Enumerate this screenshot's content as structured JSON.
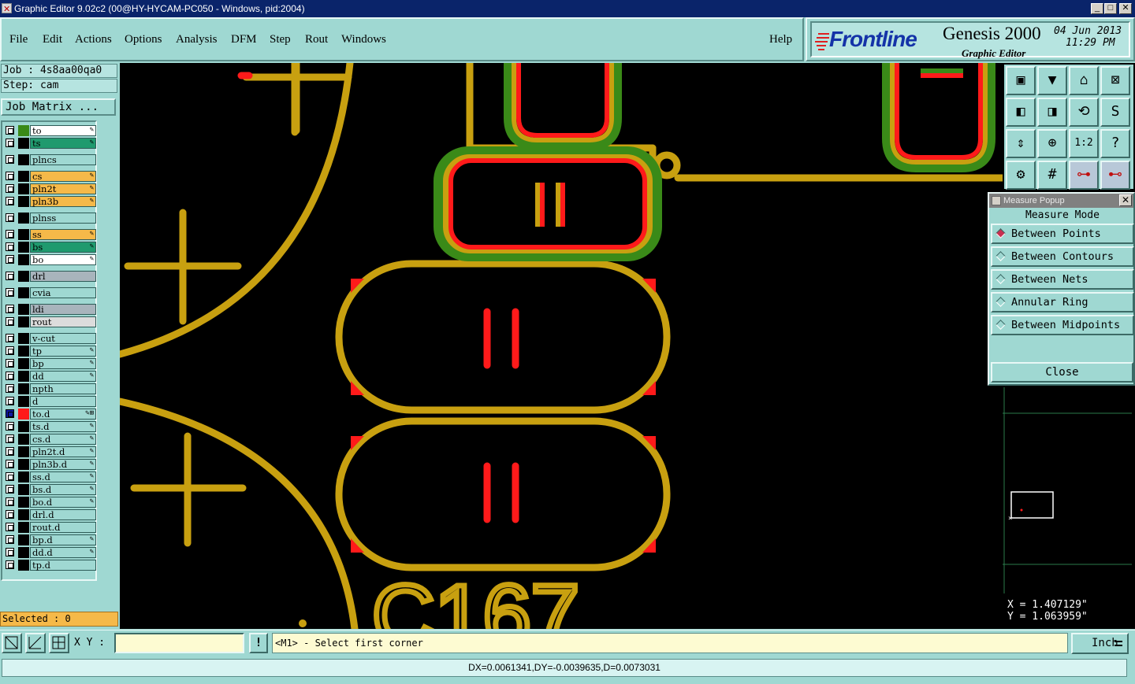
{
  "window": {
    "title": "Graphic Editor 9.02c2 (00@HY-HYCAM-PC050 - Windows, pid:2004)",
    "minimize": "_",
    "maximize": "□",
    "close": "✕"
  },
  "menu": {
    "items": [
      "File",
      "Edit",
      "Actions",
      "Options",
      "Analysis",
      "DFM",
      "Step",
      "Rout",
      "Windows"
    ],
    "help": "Help"
  },
  "branding": {
    "logo": "Frontline",
    "product": "Genesis 2000",
    "subtitle": "Graphic Editor",
    "date": "04 Jun 2013",
    "time": "11:29 PM"
  },
  "job": {
    "job_label": "Job : 4s8aa00qa0",
    "step_label": "Step: cam",
    "matrix_button": "Job Matrix ..."
  },
  "layers": [
    {
      "name": "to",
      "color": "#ffffff",
      "swatch": "#3a8a18",
      "flag": "✎"
    },
    {
      "name": "ts",
      "color": "#1f9a6e",
      "swatch": "#000000",
      "flag": "✎"
    },
    {
      "name": "plncs",
      "color": "#9fd8d2",
      "swatch": "#000000",
      "flag": ""
    },
    {
      "name": "cs",
      "color": "#f5b949",
      "swatch": "#000000",
      "flag": "✎"
    },
    {
      "name": "pln2t",
      "color": "#f5b949",
      "swatch": "#000000",
      "flag": "✎"
    },
    {
      "name": "pln3b",
      "color": "#f5b949",
      "swatch": "#000000",
      "flag": "✎"
    },
    {
      "name": "plnss",
      "color": "#9fd8d2",
      "swatch": "#000000",
      "flag": ""
    },
    {
      "name": "ss",
      "color": "#f5b949",
      "swatch": "#000000",
      "flag": "✎"
    },
    {
      "name": "bs",
      "color": "#1f9a6e",
      "swatch": "#000000",
      "flag": "✎"
    },
    {
      "name": "bo",
      "color": "#ffffff",
      "swatch": "#000000",
      "flag": "✎"
    },
    {
      "name": "drl",
      "color": "#a8b4bc",
      "swatch": "#000000",
      "flag": ""
    },
    {
      "name": "cvia",
      "color": "#9fd8d2",
      "swatch": "#000000",
      "flag": ""
    },
    {
      "name": "ldi",
      "color": "#a8b4bc",
      "swatch": "#000000",
      "flag": ""
    },
    {
      "name": "rout",
      "color": "#dcdcdc",
      "swatch": "#000000",
      "flag": ""
    },
    {
      "name": "v-cut",
      "color": "#9fd8d2",
      "swatch": "#000000",
      "flag": ""
    },
    {
      "name": "tp",
      "color": "#9fd8d2",
      "swatch": "#000000",
      "flag": "✎"
    },
    {
      "name": "bp",
      "color": "#9fd8d2",
      "swatch": "#000000",
      "flag": "✎"
    },
    {
      "name": "dd",
      "color": "#9fd8d2",
      "swatch": "#000000",
      "flag": "✎"
    },
    {
      "name": "npth",
      "color": "#9fd8d2",
      "swatch": "#000000",
      "flag": ""
    },
    {
      "name": "d",
      "color": "#9fd8d2",
      "swatch": "#000000",
      "flag": ""
    },
    {
      "name": "to.d",
      "color": "#9fd8d2",
      "swatch": "#ff1a1a",
      "flag": "✎⊞",
      "active": true
    },
    {
      "name": "ts.d",
      "color": "#9fd8d2",
      "swatch": "#000000",
      "flag": "✎"
    },
    {
      "name": "cs.d",
      "color": "#9fd8d2",
      "swatch": "#000000",
      "flag": "✎"
    },
    {
      "name": "pln2t.d",
      "color": "#9fd8d2",
      "swatch": "#000000",
      "flag": "✎"
    },
    {
      "name": "pln3b.d",
      "color": "#9fd8d2",
      "swatch": "#000000",
      "flag": "✎"
    },
    {
      "name": "ss.d",
      "color": "#9fd8d2",
      "swatch": "#000000",
      "flag": "✎"
    },
    {
      "name": "bs.d",
      "color": "#9fd8d2",
      "swatch": "#000000",
      "flag": "✎"
    },
    {
      "name": "bo.d",
      "color": "#9fd8d2",
      "swatch": "#000000",
      "flag": "✎"
    },
    {
      "name": "drl.d",
      "color": "#9fd8d2",
      "swatch": "#000000",
      "flag": ""
    },
    {
      "name": "rout.d",
      "color": "#9fd8d2",
      "swatch": "#000000",
      "flag": ""
    },
    {
      "name": "bp.d",
      "color": "#9fd8d2",
      "swatch": "#000000",
      "flag": "✎"
    },
    {
      "name": "dd.d",
      "color": "#9fd8d2",
      "swatch": "#000000",
      "flag": "✎"
    },
    {
      "name": "tp.d",
      "color": "#9fd8d2",
      "swatch": "#000000",
      "flag": ""
    }
  ],
  "selected": "Selected : 0",
  "canvas": {
    "silkscreen_text": "C167",
    "colors": {
      "copper": "#c8a010",
      "drawing": "#ff1a1a",
      "mask": "#3a8a18",
      "background": "#000000"
    }
  },
  "measure_popup": {
    "title": "Measure Popup",
    "header": "Measure Mode",
    "options": [
      "Between Points",
      "Between Contours",
      "Between Nets",
      "Annular Ring",
      "Between Midpoints"
    ],
    "selected_index": 0,
    "close_button": "Close"
  },
  "coords": {
    "x": "X = 1.407129\"",
    "y": "Y = 1.063959\""
  },
  "bottom": {
    "xy_label": "X Y :",
    "xy_value": "",
    "excl_label": "!",
    "prompt": "<M1> - Select first corner",
    "unit": "Inch"
  },
  "status": "DX=0.0061341,DY=-0.0039635,D=0.0073031"
}
